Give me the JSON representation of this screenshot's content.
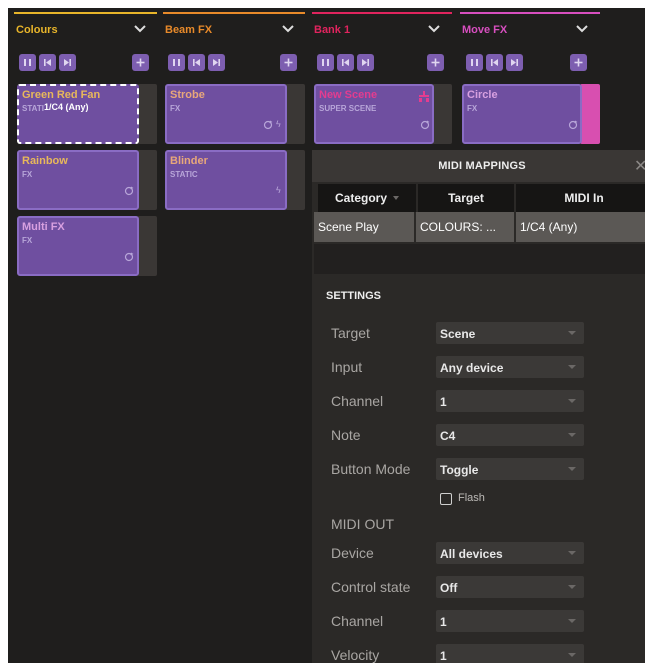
{
  "banks": [
    {
      "name": "Colours",
      "color": "#e8b52a"
    },
    {
      "name": "Beam FX",
      "color": "#e88a2a"
    },
    {
      "name": "Bank 1",
      "color": "#e0245e"
    },
    {
      "name": "Move FX",
      "color": "#d84fc0"
    }
  ],
  "tiles": {
    "green_red_fan": {
      "title": "Green Red Fan",
      "type": "STATI",
      "mapping": "1/C4 (Any)"
    },
    "rainbow": {
      "title": "Rainbow",
      "type": "FX"
    },
    "multi_fx": {
      "title": "Multi FX",
      "type": "FX"
    },
    "strobe": {
      "title": "Strobe",
      "type": "FX"
    },
    "blinder": {
      "title": "Blinder",
      "type": "STATIC"
    },
    "new_scene": {
      "title": "New Scene",
      "type": "SUPER SCENE"
    },
    "circle": {
      "title": "Circle",
      "type": "FX"
    }
  },
  "midi_panel": {
    "title": "MIDI MAPPINGS",
    "columns": [
      "Category",
      "Target",
      "MIDI In"
    ],
    "rows": [
      {
        "category": "Scene Play",
        "target": "COLOURS: ...",
        "midi_in": "1/C4 (Any)"
      }
    ],
    "settings_title": "SETTINGS",
    "settings": [
      {
        "label": "Target",
        "value": "Scene"
      },
      {
        "label": "Input",
        "value": "Any device"
      },
      {
        "label": "Channel",
        "value": "1"
      },
      {
        "label": "Note",
        "value": "C4"
      },
      {
        "label": "Button Mode",
        "value": "Toggle"
      }
    ],
    "flash_label": "Flash",
    "flash_checked": false,
    "midi_out_title": "MIDI OUT",
    "midi_out": [
      {
        "label": "Device",
        "value": "All devices"
      },
      {
        "label": "Control state",
        "value": "Off"
      },
      {
        "label": "Channel",
        "value": "1"
      },
      {
        "label": "Velocity",
        "value": "1"
      }
    ]
  },
  "colors": {
    "background": "#1f1e1d",
    "tile": "#6f4fa0",
    "tile_border": "#8a6cc4",
    "panel": "#2b2927",
    "table_header": "#161514",
    "selected_row": "#5b5855"
  }
}
